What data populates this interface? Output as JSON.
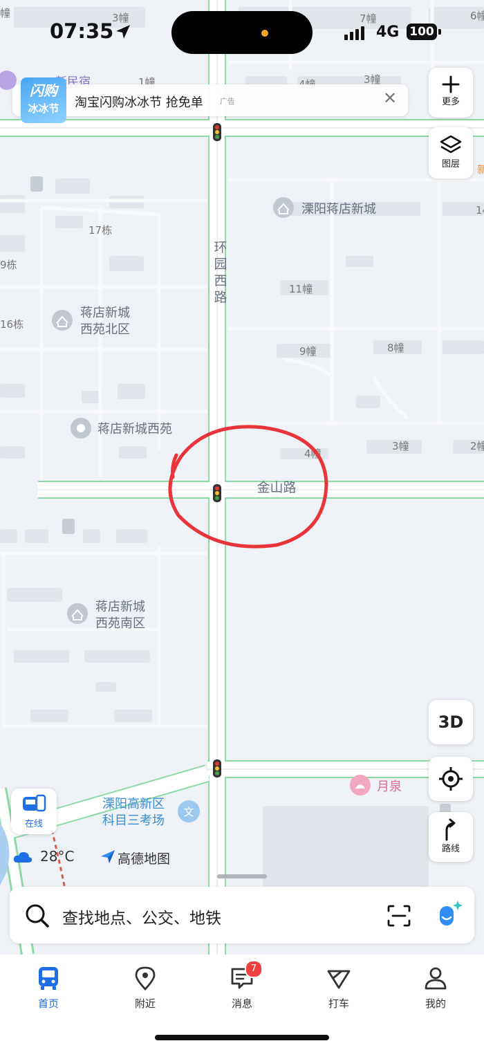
{
  "status_bar": {
    "time": "07:35",
    "network": "4G",
    "battery": "100"
  },
  "ad_banner": {
    "logo_line1": "闪购",
    "logo_line2": "冰冰节",
    "text": "淘宝闪购冰冰节 抢免单",
    "tag": "广告"
  },
  "map": {
    "roads": {
      "north_south": "环园西路",
      "east_west": "金山路"
    },
    "pois": {
      "liyang_jiangdian": "溧阳蒋店新城",
      "xiyuan_north_1": "蒋店新城",
      "xiyuan_north_2": "西苑北区",
      "xiyuan": "蒋店新城西苑",
      "xiyuan_south_1": "蒋店新城",
      "xiyuan_south_2": "西苑南区",
      "exam_1": "溧阳高新区",
      "exam_2": "科目三考场",
      "yuequan": "月泉",
      "partial_top": "新民宿"
    },
    "buildings": [
      "3幢",
      "7幢",
      "6幢",
      "3幢",
      "4幢",
      "1幢",
      "14",
      "17栋",
      "9栋",
      "16栋",
      "11幢",
      "9幢",
      "8幢",
      "3幢",
      "4幢",
      "2幢"
    ],
    "partial_left_top": "幢",
    "partial_right_edge": "新"
  },
  "right_controls": {
    "more_label": "更多",
    "layers_label": "图层",
    "threed_label": "3D",
    "route_label": "路线"
  },
  "left_controls": {
    "live_label": "在线"
  },
  "weather": {
    "temp": "28°C"
  },
  "brand": {
    "name": "高德地图"
  },
  "search": {
    "placeholder": "查找地点、公交、地铁"
  },
  "tabs": [
    {
      "label": "首页",
      "active": true
    },
    {
      "label": "附近",
      "active": false
    },
    {
      "label": "消息",
      "active": false,
      "badge": "7"
    },
    {
      "label": "打车",
      "active": false
    },
    {
      "label": "我的",
      "active": false
    }
  ],
  "colors": {
    "accent": "#1e6fe6",
    "road_edge": "#8fd9a8",
    "annotation": "#e8343a",
    "badge": "#f04040"
  }
}
